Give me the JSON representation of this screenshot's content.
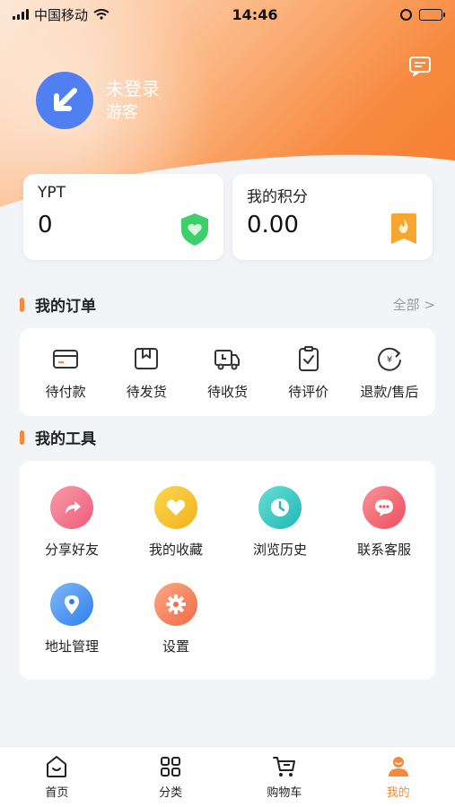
{
  "status_bar": {
    "carrier": "中国移动",
    "time": "14:46"
  },
  "profile": {
    "name": "未登录",
    "role": "游客"
  },
  "cards": [
    {
      "label": "YPT",
      "value": "0",
      "badge_icon": "shield-heart-icon"
    },
    {
      "label": "我的积分",
      "value": "0.00",
      "badge_icon": "points-flame-icon"
    }
  ],
  "orders": {
    "title": "我的订单",
    "see_all": "全部 >",
    "items": [
      {
        "label": "待付款",
        "icon": "card-icon"
      },
      {
        "label": "待发货",
        "icon": "box-icon"
      },
      {
        "label": "待收货",
        "icon": "truck-icon"
      },
      {
        "label": "待评价",
        "icon": "clipboard-check-icon"
      },
      {
        "label": "退款/售后",
        "icon": "refund-icon"
      }
    ]
  },
  "tools": {
    "title": "我的工具",
    "items": [
      {
        "label": "分享好友",
        "icon": "share-icon",
        "color": "#f06a84"
      },
      {
        "label": "我的收藏",
        "icon": "heart-icon",
        "color": "#f5c02b"
      },
      {
        "label": "浏览历史",
        "icon": "clock-icon",
        "color": "#2ec4c2"
      },
      {
        "label": "联系客服",
        "icon": "chat-icon",
        "color": "#f2616a"
      },
      {
        "label": "地址管理",
        "icon": "location-pin-icon",
        "color": "#3f8ff0"
      },
      {
        "label": "设置",
        "icon": "gear-icon",
        "color": "#f6825a"
      }
    ]
  },
  "tabbar": {
    "items": [
      {
        "label": "首页",
        "icon": "home-icon"
      },
      {
        "label": "分类",
        "icon": "grid-icon"
      },
      {
        "label": "购物车",
        "icon": "cart-icon"
      },
      {
        "label": "我的",
        "icon": "user-icon"
      }
    ],
    "active": "我的"
  },
  "colors": {
    "accent": "#f7893a",
    "avatar": "#4f7ff0",
    "shield": "#3fcf6a",
    "points_badge": "#f6a52f"
  }
}
